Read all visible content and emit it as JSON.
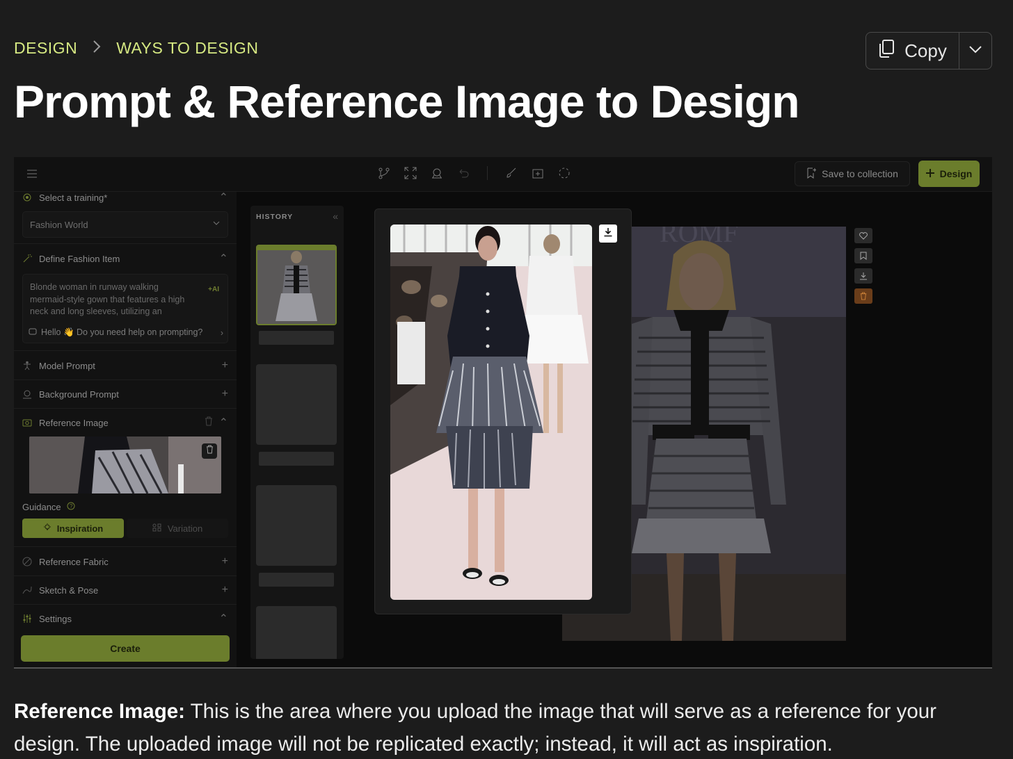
{
  "breadcrumb": {
    "items": [
      "DESIGN",
      "WAYS TO DESIGN"
    ]
  },
  "copy_button": {
    "label": "Copy"
  },
  "page_title": "Prompt & Reference Image to Design",
  "app": {
    "topbar": {
      "tools": [
        "branch-icon",
        "expand-icon",
        "brain-icon",
        "undo-icon",
        "brush-icon",
        "frame-icon",
        "select-icon"
      ],
      "save_label": "Save to collection",
      "design_label": "Design"
    },
    "left_panel": {
      "training_label": "Select a training*",
      "training_value": "Fashion World",
      "define_label": "Define Fashion Item",
      "define_text": "Blonde woman in runway walking mermaid-style gown that features a high neck and long sleeves, utilizing an",
      "ai_badge": "+AI",
      "helper_text": "Hello 👋 Do you need help on prompting?",
      "model_prompt": "Model Prompt",
      "background_prompt": "Background Prompt",
      "reference_image": "Reference Image",
      "guidance_label": "Guidance",
      "inspiration_label": "Inspiration",
      "variation_label": "Variation",
      "reference_fabric": "Reference Fabric",
      "sketch_pose": "Sketch & Pose",
      "settings": "Settings",
      "create_label": "Create"
    },
    "history": {
      "title": "HISTORY"
    },
    "colors": {
      "accent": "#6b7d2c",
      "breadcrumb": "#d6e982"
    }
  },
  "caption": {
    "bold": "Reference Image:",
    "text": " This is the area where you upload the image that will serve as a reference for your design. The uploaded image will not be replicated exactly; instead, it will act as inspiration."
  }
}
